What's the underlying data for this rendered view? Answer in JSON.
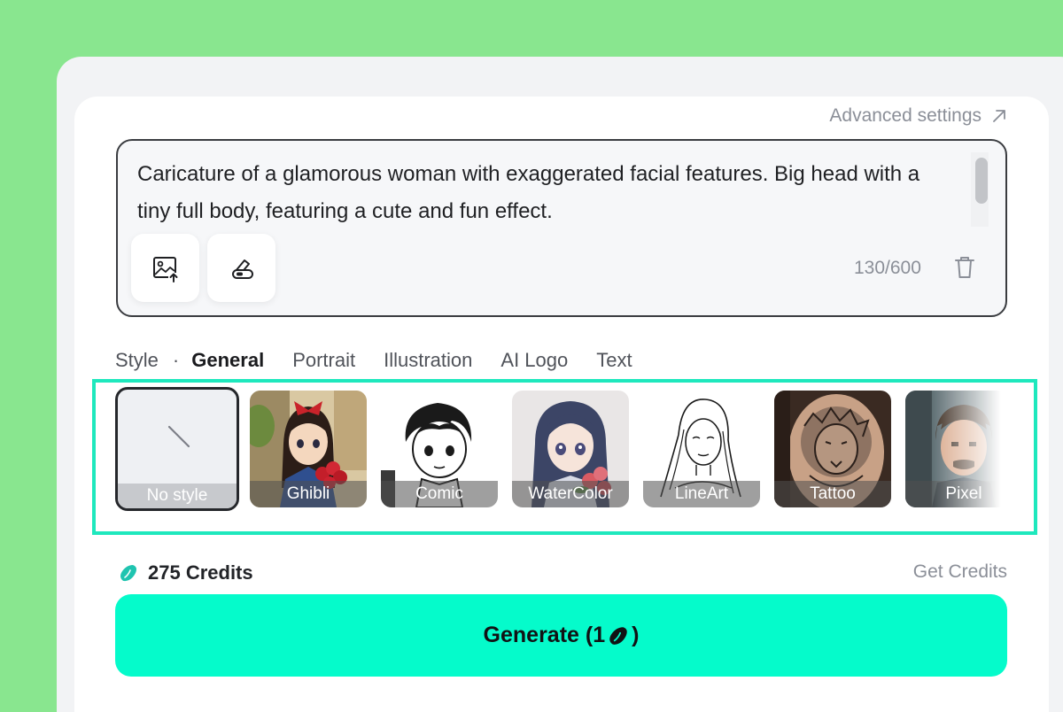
{
  "header": {
    "advanced_settings_label": "Advanced settings",
    "advanced_icon": "arrow-up-right-icon"
  },
  "prompt": {
    "text": "Caricature of a glamorous woman with exaggerated facial features. Big head with a tiny full body, featuring a cute and fun effect.",
    "char_count": "130/600",
    "tools": [
      {
        "icon": "image-upload-icon"
      },
      {
        "icon": "eraser-pen-icon"
      }
    ],
    "clear_icon": "trash-icon"
  },
  "style": {
    "label": "Style",
    "separator": "·",
    "tabs": [
      {
        "label": "General",
        "active": true
      },
      {
        "label": "Portrait",
        "active": false
      },
      {
        "label": "Illustration",
        "active": false
      },
      {
        "label": "AI Logo",
        "active": false
      },
      {
        "label": "Text",
        "active": false
      }
    ],
    "options": [
      {
        "label": "No style",
        "selected": true
      },
      {
        "label": "Ghibli",
        "selected": false
      },
      {
        "label": "Comic",
        "selected": false
      },
      {
        "label": "WaterColor",
        "selected": false
      },
      {
        "label": "LineArt",
        "selected": false
      },
      {
        "label": "Tattoo",
        "selected": false
      },
      {
        "label": "Pixel",
        "selected": false
      }
    ]
  },
  "credits": {
    "label": "275 Credits",
    "icon": "bean-icon",
    "get_credits_label": "Get Credits"
  },
  "generate": {
    "label_prefix": "Generate (1",
    "label_suffix": ")"
  },
  "colors": {
    "background": "#89e68f",
    "accent": "#05fbcb",
    "highlight_border": "#1ee8bd",
    "bean": "#1fc4b0"
  }
}
